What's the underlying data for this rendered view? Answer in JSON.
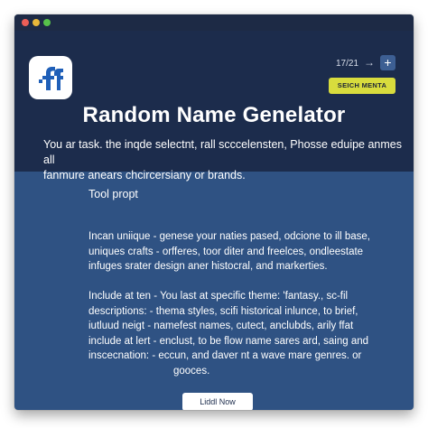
{
  "header": {
    "time": "17/21",
    "arrow_icon": "arrow-right-icon",
    "add_icon": "plus-icon",
    "add_label": "+",
    "arrow_label": "→",
    "search_label": "SEICH MENTA",
    "title": "Random Name Genelator",
    "subtitle_lines": [
      "You ar task.  the inqde selectnt, rall scccelensten, Phosse eduipe anmes all",
      "fanmure anears chcircersiany or brands."
    ]
  },
  "content": {
    "section_label": "Tool propt",
    "para1_lines": [
      "Incan uniique  -   genese your naties pased,  odcione to ill base,",
      "uniques crafts  -  orfferes, toor diter and freelces, ondleestate",
      "infuges srater     design aner histocral, and markerties."
    ],
    "para2_lines": [
      "Include at ten  -   You last at specific theme: 'fantasy., sc-fil",
      "descriptions:   -  thema styles, scifi historical inlunce, to brief,",
      "iutluud neigt   -  namefest names, cutect, anclubds,  arily ffat",
      "include at lert  -   enclust, to be flow name sares ard,  saing and",
      "inscecnation:   -  eccun, and daver nt a wave mare genres. or",
      "                              gooces."
    ],
    "action_label": "Liddl Now"
  },
  "colors": {
    "window_bg": "#2f5283",
    "header_bg": "#1c2c4c",
    "accent_yellow": "#d8dc3d",
    "logo_blue": "#1f5fb8"
  }
}
